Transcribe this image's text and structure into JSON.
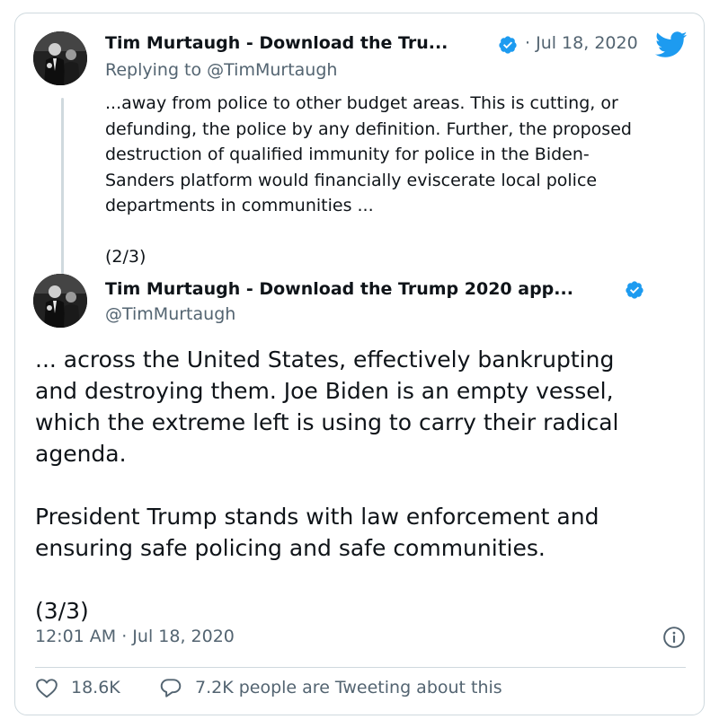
{
  "tweet1": {
    "author_name": "Tim Murtaugh - Download the Tru...",
    "separator": "·",
    "date": "Jul 18, 2020",
    "replying_to_prefix": "Replying to ",
    "replying_to_handle": "@TimMurtaugh",
    "text": "...away from police to other budget areas. This is cutting, or\ndefunding, the police by any definition. Further, the proposed\ndestruction of qualified immunity for police in the Biden-\nSanders platform would financially eviscerate local police\ndepartments in communities ...\n\n(2/3)"
  },
  "tweet2": {
    "author_name": "Tim Murtaugh - Download the Trump 2020 app...",
    "handle": "@TimMurtaugh",
    "text": "... across the United States, effectively bankrupting\nand destroying them. Joe Biden is an empty vessel,\nwhich the extreme left is using to carry their radical\nagenda.\n\nPresident Trump stands with law enforcement and\nensuring safe policing and safe communities.\n\n(3/3)",
    "timestamp": "12:01 AM · Jul 18, 2020"
  },
  "actions": {
    "likes": "18.6K",
    "conversation": "7.2K people are Tweeting about this"
  },
  "colors": {
    "accent": "#1d9bf0",
    "text_primary": "#0f1419",
    "text_secondary": "#536471",
    "border": "#cfd9de"
  },
  "icons": {
    "verified": "verified-badge-icon",
    "twitter": "twitter-bird-icon",
    "info": "info-icon",
    "like": "heart-icon",
    "reply": "speech-bubble-icon"
  }
}
